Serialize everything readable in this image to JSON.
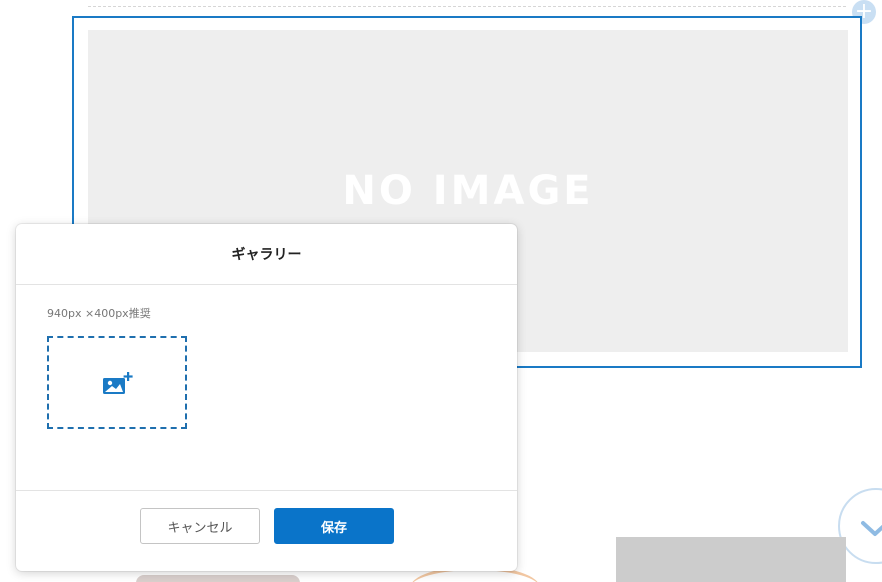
{
  "background": {
    "placeholder_text": "NO IMAGE",
    "add_button_glyph": "+"
  },
  "modal": {
    "title": "ギャラリー",
    "size_hint": "940px ×400px推奨",
    "upload_icon": "image-add-icon",
    "cancel_label": "キャンセル",
    "save_label": "保存"
  },
  "colors": {
    "accent": "#0a74c9",
    "selection_border": "#1a7ac5",
    "placeholder_bg": "#eeeeee"
  }
}
